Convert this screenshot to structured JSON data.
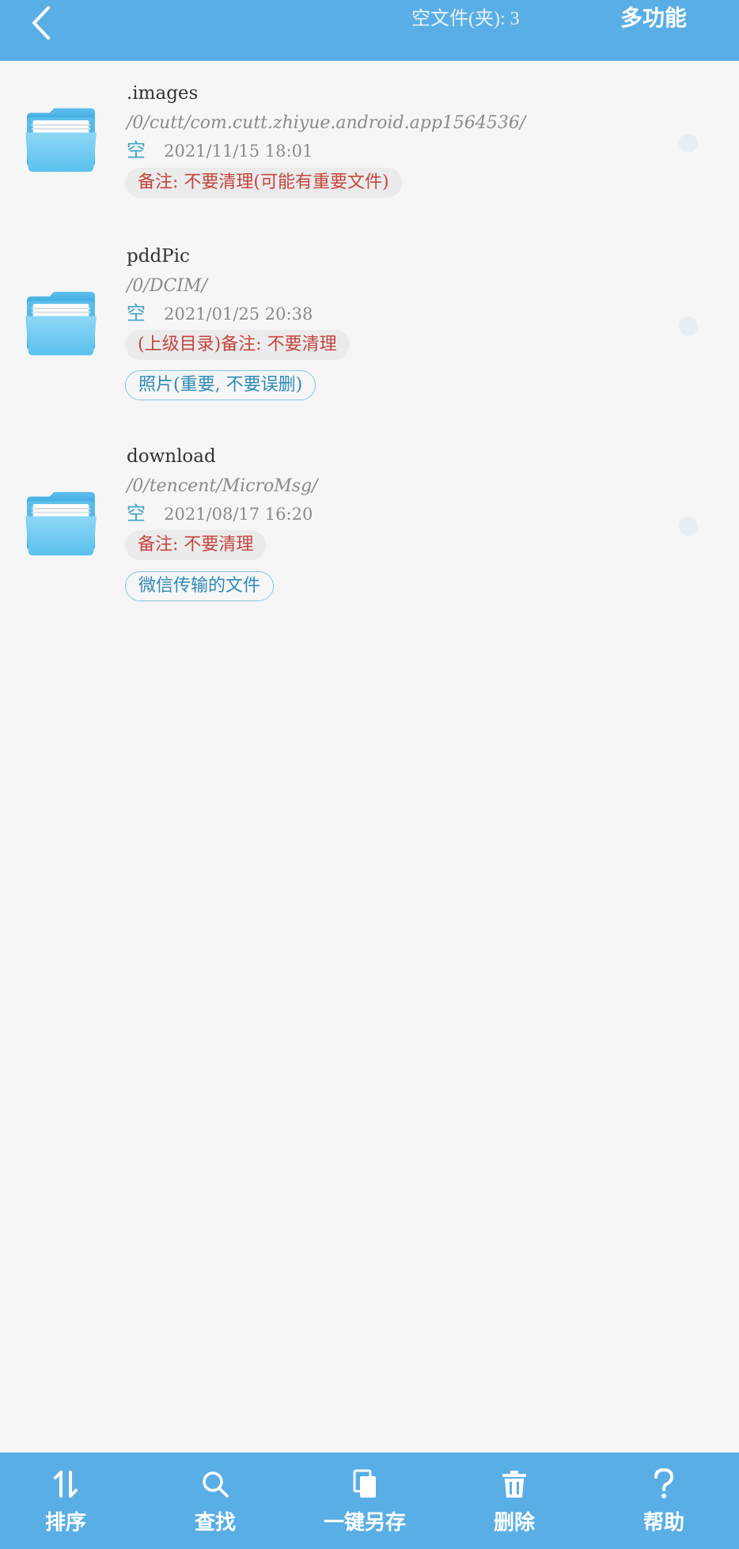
{
  "header": {
    "back_icon": "chevron-left-icon",
    "empty_count": "空文件(夹): 3",
    "multi_function": "多功能"
  },
  "items": [
    {
      "name": ".images",
      "path": "/0/cutt/com.cutt.zhiyue.android.app1564536/",
      "status": "空",
      "date": "2021/11/15 18:01",
      "note": "备注: 不要清理(可能有重要文件)",
      "tag": ""
    },
    {
      "name": "pddPic",
      "path": "/0/DCIM/",
      "status": "空",
      "date": "2021/01/25 20:38",
      "note": "(上级目录)备注: 不要清理",
      "tag": "照片(重要, 不要误删)"
    },
    {
      "name": "download",
      "path": "/0/tencent/MicroMsg/",
      "status": "空",
      "date": "2021/08/17 16:20",
      "note": "备注: 不要清理",
      "tag": "微信传输的文件"
    }
  ],
  "toolbar": {
    "sort": "排序",
    "find": "查找",
    "save_all": "一键另存",
    "delete": "删除",
    "help": "帮助"
  },
  "colors": {
    "accent": "#5aaee6",
    "note_text": "#c4463f",
    "tag_text": "#2f8bb5",
    "status_text": "#3fa2c6"
  }
}
